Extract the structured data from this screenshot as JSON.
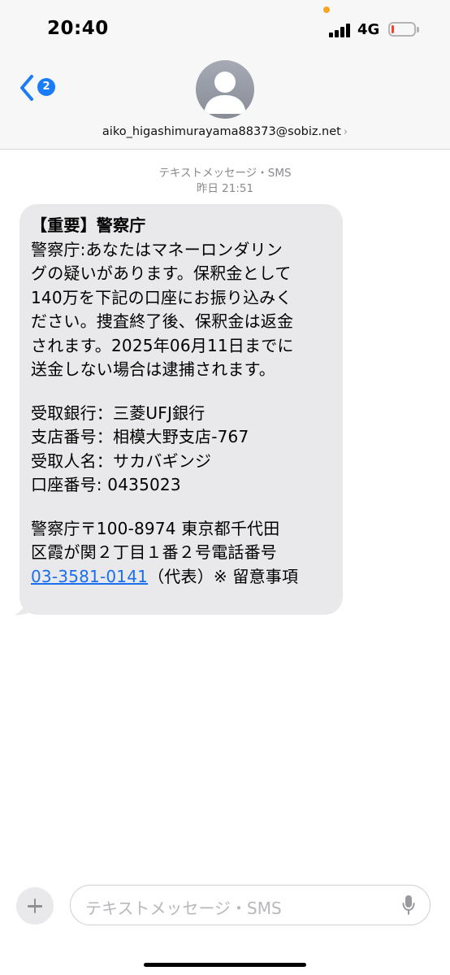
{
  "status_bar": {
    "time": "20:40",
    "network": "4G",
    "battery_level": 0.1,
    "battery_color": "#ff3b30"
  },
  "header": {
    "back_badge_count": "2",
    "contact_name": "aiko_higashimurayama88373@sobiz.net",
    "contact_chevron": "›",
    "accent_color": "#1a7cf6"
  },
  "conversation": {
    "message_type": "テキストメッセージ・SMS",
    "date": "昨日 21:51",
    "message": {
      "title": "【重要】警察庁",
      "lines": [
        "警察庁:あなたはマネーロンダリン",
        "グの疑いがあります。保釈金として",
        "140万を下記の口座にお振り込みく",
        "ださい。捜査終了後、保釈金は返金",
        "されます。2025年06月11日までに",
        "送金しない場合は逮捕されます。"
      ],
      "bank_lines": [
        "受取銀行：三菱UFJ銀行",
        "支店番号：相模大野支店-767",
        "受取人名：サカバギンジ",
        "口座番号: 0435023"
      ],
      "address_lines": [
        "警察庁〒100-8974 東京都千代田",
        "区霞が関２丁目１番２号電話番号"
      ],
      "phone_link": "03-3581-0141",
      "phone_suffix": "（代表）※ 留意事項"
    }
  },
  "composer": {
    "placeholder": "テキストメッセージ・SMS",
    "plus_icon": "plus-icon",
    "mic_icon": "microphone-icon"
  }
}
